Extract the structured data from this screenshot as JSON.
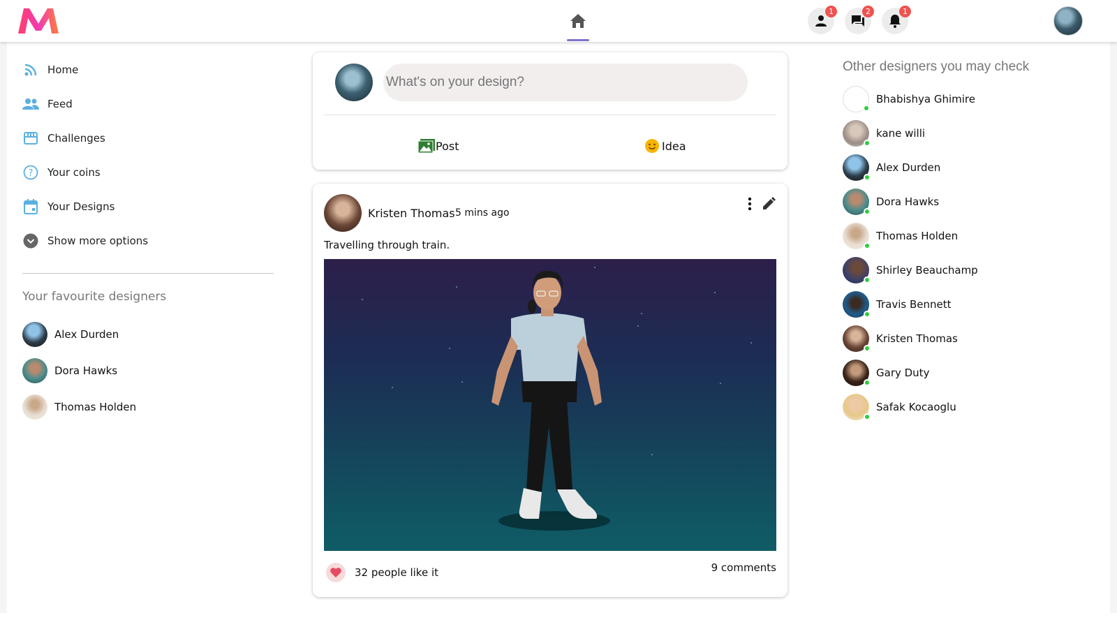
{
  "colors": {
    "accent": "#7b74c9",
    "badge": "#ef5350",
    "online": "#2ecc40",
    "like": "#e84a5f",
    "menu_icon": "#5ab0e0"
  },
  "topbar": {
    "logo_icon": "myntra-m-logo",
    "home_icon": "home-icon",
    "notifications": [
      {
        "icon": "person-icon",
        "badge": "1"
      },
      {
        "icon": "chat-icon",
        "badge": "2"
      },
      {
        "icon": "bell-icon",
        "badge": "1"
      }
    ]
  },
  "sidebar": {
    "items": [
      {
        "label": "Home",
        "icon": "rss-icon"
      },
      {
        "label": "Feed",
        "icon": "people-icon"
      },
      {
        "label": "Challenges",
        "icon": "store-icon"
      },
      {
        "label": "Your coins",
        "icon": "help-circle-icon"
      },
      {
        "label": "Your Designs",
        "icon": "calendar-icon"
      },
      {
        "label": "Show more options",
        "icon": "chevron-down-circle-icon"
      }
    ],
    "favourites_title": "Your favourite designers",
    "favourites": [
      {
        "name": "Alex Durden"
      },
      {
        "name": "Dora Hawks"
      },
      {
        "name": "Thomas Holden"
      }
    ]
  },
  "composer": {
    "placeholder": "What's on your design?",
    "post_label": "Post",
    "idea_label": "Idea"
  },
  "post": {
    "author": "Kristen Thomas",
    "time": "5 mins ago",
    "caption": "Travelling through train.",
    "likes": "32 people like it",
    "comments": "9 comments"
  },
  "others": {
    "title": "Other designers you may check",
    "people": [
      {
        "name": "Bhabishya Ghimire"
      },
      {
        "name": "kane willi"
      },
      {
        "name": "Alex Durden"
      },
      {
        "name": "Dora Hawks"
      },
      {
        "name": "Thomas Holden"
      },
      {
        "name": "Shirley Beauchamp"
      },
      {
        "name": "Travis Bennett"
      },
      {
        "name": "Kristen Thomas"
      },
      {
        "name": "Gary Duty"
      },
      {
        "name": "Safak Kocaoglu"
      }
    ]
  }
}
